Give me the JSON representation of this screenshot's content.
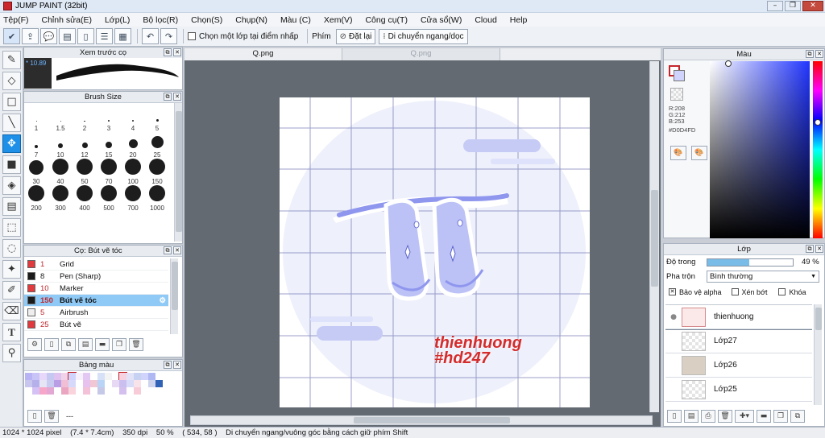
{
  "window": {
    "title": "JUMP PAINT (32bit)",
    "minimize": "–",
    "maximize": "❐",
    "close": "✕"
  },
  "menu": [
    "Tệp(F)",
    "Chỉnh sửa(E)",
    "Lớp(L)",
    "Bộ lọc(R)",
    "Chọn(S)",
    "Chụp(N)",
    "Màu (C)",
    "Xem(V)",
    "Công cụ(T)",
    "Cửa sổ(W)",
    "Cloud",
    "Help"
  ],
  "toolbar": {
    "pick_layer_label": "Chọn một lớp tại điểm nhấp",
    "key_label": "Phím",
    "reset_label": "Đặt lại",
    "move_hv_label": "Di chuyển ngang/dọc"
  },
  "brush_preview": {
    "title": "Xem trước cọ",
    "size_text": "* 10.89"
  },
  "brush_size": {
    "title": "Brush Size",
    "sizes": [
      "1",
      "1.5",
      "2",
      "3",
      "4",
      "5",
      "7",
      "10",
      "12",
      "15",
      "20",
      "25",
      "30",
      "40",
      "50",
      "70",
      "100",
      "150",
      "200",
      "300",
      "400",
      "500",
      "700",
      "1000"
    ]
  },
  "brush_list": {
    "title": "Cọ: Bút vẽ tóc",
    "items": [
      {
        "size": "1",
        "name": "Grid",
        "color": "#e03a3e"
      },
      {
        "size": "8",
        "name": "Pen (Sharp)",
        "color": "#1a1a1a"
      },
      {
        "size": "10",
        "name": "Marker",
        "color": "#e03a3e"
      },
      {
        "size": "150",
        "name": "Bút vẽ tóc",
        "color": "#1a1a1a",
        "selected": true
      },
      {
        "size": "5",
        "name": "Airbrush",
        "color": "#eeeeee"
      },
      {
        "size": "25",
        "name": "Bút vẽ",
        "color": "#e03a3e"
      }
    ]
  },
  "palette": {
    "title": "Bảng màu",
    "bottom_text": "---"
  },
  "tabs": [
    {
      "label": "Q.png"
    },
    {
      "label": "Q.png"
    }
  ],
  "canvas": {
    "text_line1": "thienhuong",
    "text_line2": "#hd247",
    "text_color": "#d42c2c"
  },
  "color_panel": {
    "title": "Màu",
    "r": "R:208",
    "g": "G:212",
    "b": "B:253",
    "hex": "#D0D4FD"
  },
  "layer_panel": {
    "title": "Lớp",
    "opacity_label": "Độ trong",
    "opacity_value": "49 %",
    "blend_label": "Pha trộn",
    "blend_value": "Bình thường",
    "protect_alpha": "Bảo vệ alpha",
    "clip": "Xén bớt",
    "lock": "Khóa",
    "layers": [
      {
        "name": "thienhuong",
        "active": true
      },
      {
        "name": "Lớp27"
      },
      {
        "name": "Lớp26"
      },
      {
        "name": "Lớp25"
      }
    ]
  },
  "status": {
    "size": "1024 * 1024 pixel",
    "cm": "(7.4 * 7.4cm)",
    "dpi": "350 dpi",
    "zoom": "50 %",
    "coords": "( 534, 58 )",
    "hint": "Di chuyển ngang/vuông góc bằng cách giữ phím Shift"
  }
}
